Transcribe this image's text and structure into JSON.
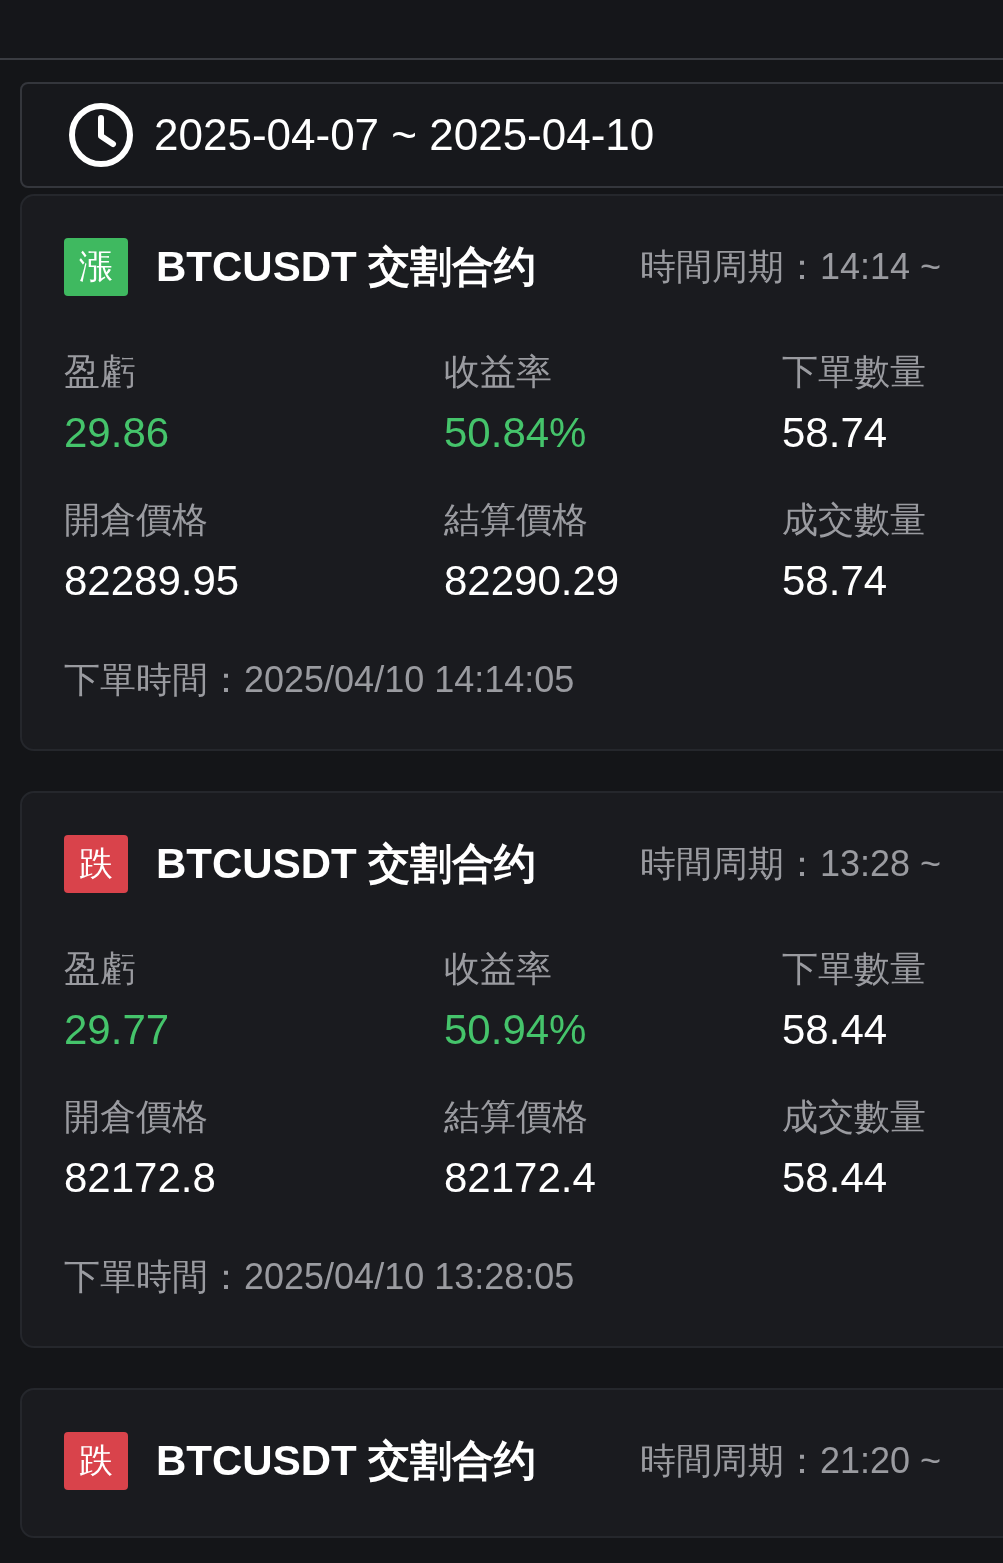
{
  "date_range": "2025-04-07 ~ 2025-04-10",
  "orders": [
    {
      "kind": "up",
      "badge": "漲",
      "symbol": "BTCUSDT 交割合约",
      "period": "時間周期：14:14 ~",
      "metrics": [
        {
          "label": "盈虧",
          "value": "29.86",
          "kind": "gain"
        },
        {
          "label": "收益率",
          "value": "50.84%",
          "kind": "gain"
        },
        {
          "label": "下單數量",
          "value": "58.74",
          "kind": "plain"
        },
        {
          "label": "開倉價格",
          "value": "82289.95",
          "kind": "plain"
        },
        {
          "label": "結算價格",
          "value": "82290.29",
          "kind": "plain"
        },
        {
          "label": "成交數量",
          "value": "58.74",
          "kind": "plain"
        }
      ],
      "order_time": "下單時間：2025/04/10 14:14:05"
    },
    {
      "kind": "down",
      "badge": "跌",
      "symbol": "BTCUSDT 交割合约",
      "period": "時間周期：13:28 ~",
      "metrics": [
        {
          "label": "盈虧",
          "value": "29.77",
          "kind": "gain"
        },
        {
          "label": "收益率",
          "value": "50.94%",
          "kind": "gain"
        },
        {
          "label": "下單數量",
          "value": "58.44",
          "kind": "plain"
        },
        {
          "label": "開倉價格",
          "value": "82172.8",
          "kind": "plain"
        },
        {
          "label": "結算價格",
          "value": "82172.4",
          "kind": "plain"
        },
        {
          "label": "成交數量",
          "value": "58.44",
          "kind": "plain"
        }
      ],
      "order_time": "下單時間：2025/04/10 13:28:05"
    },
    {
      "kind": "down",
      "badge": "跌",
      "symbol": "BTCUSDT 交割合约",
      "period": "時間周期：21:20 ~"
    }
  ]
}
